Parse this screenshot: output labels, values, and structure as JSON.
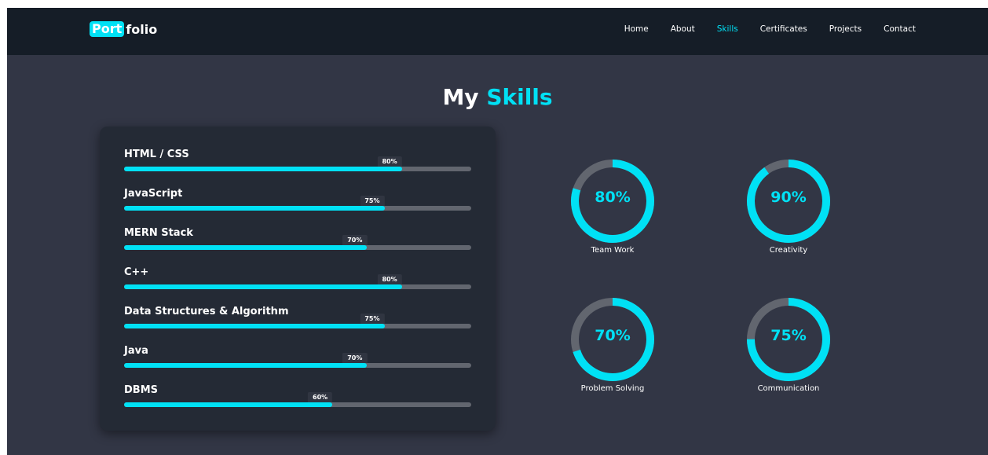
{
  "logo": {
    "highlight": "Port",
    "rest": "folio"
  },
  "nav": {
    "items": [
      {
        "label": "Home",
        "active": false
      },
      {
        "label": "About",
        "active": false
      },
      {
        "label": "Skills",
        "active": true
      },
      {
        "label": "Certificates",
        "active": false
      },
      {
        "label": "Projects",
        "active": false
      },
      {
        "label": "Contact",
        "active": false
      }
    ]
  },
  "section": {
    "title_plain": "My",
    "title_accent": "Skills"
  },
  "skills": [
    {
      "name": "HTML / CSS",
      "percent_label": "80%",
      "level": 0.8
    },
    {
      "name": "JavaScript",
      "percent_label": "75%",
      "level": 0.75
    },
    {
      "name": "MERN Stack",
      "percent_label": "70%",
      "level": 0.7
    },
    {
      "name": "C++",
      "percent_label": "80%",
      "level": 0.8
    },
    {
      "name": "Data Structures & Algorithm",
      "percent_label": "75%",
      "level": 0.75
    },
    {
      "name": "Java",
      "percent_label": "70%",
      "level": 0.7
    },
    {
      "name": "DBMS",
      "percent_label": "60%",
      "level": 0.6
    }
  ],
  "soft_skills": [
    {
      "label": "Team Work",
      "percent_label": "80%",
      "level": 0.8
    },
    {
      "label": "Creativity",
      "percent_label": "90%",
      "level": 0.9
    },
    {
      "label": "Problem Solving",
      "percent_label": "70%",
      "level": 0.7
    },
    {
      "label": "Communication",
      "percent_label": "75%",
      "level": 0.75
    }
  ],
  "colors": {
    "accent": "#00e1f5",
    "track": "#62666f",
    "page_bg": "#323645",
    "nav_bg": "#151d27",
    "card_bg": "#242a35"
  }
}
